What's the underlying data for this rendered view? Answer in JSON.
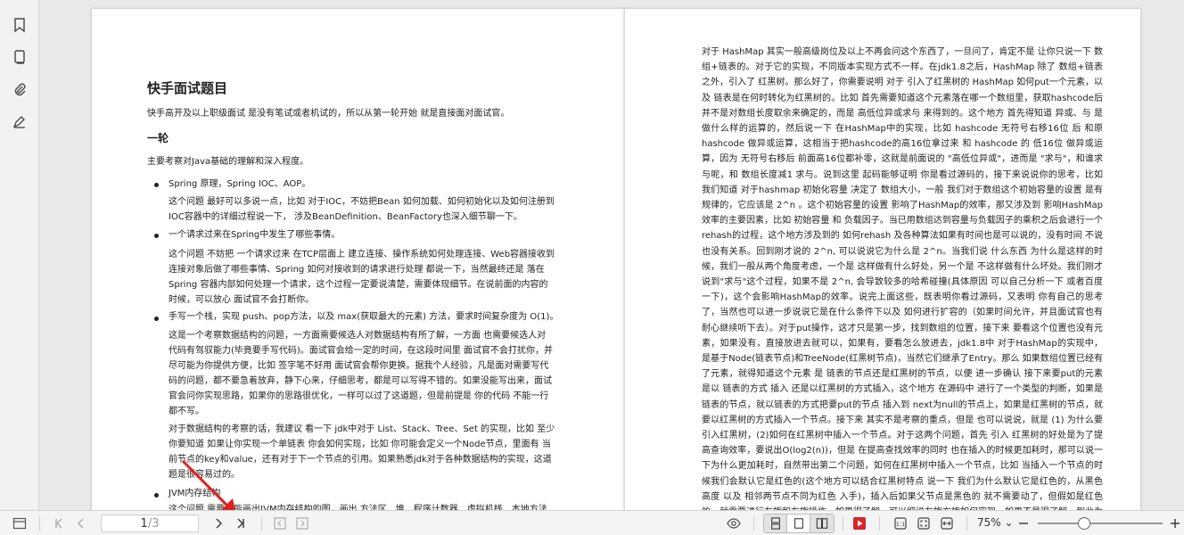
{
  "sidebar": {
    "items": [
      {
        "icon": "bookmark-icon"
      },
      {
        "icon": "thumbnails-icon"
      },
      {
        "icon": "attachment-icon"
      },
      {
        "icon": "signature-icon"
      }
    ]
  },
  "document": {
    "title": "快手面试题目",
    "intro": "快手高开及以上职级面试 是没有笔试或者机试的，所以从第一轮开始 就是直接面对面试官。",
    "section": "一轮",
    "section_intro": "主要考察对Java基础的理解和深入程度。",
    "bullets": [
      {
        "head": "Spring 原理，Spring IOC、AOP。",
        "body": [
          "这个问题 最好可以多说一点，比如 对于IOC，不妨把Bean 如何加载、如何初始化以及如何注册到",
          "IOC容器中的详细过程说一下， 涉及BeanDefinition、BeanFactory也深入细节聊一下。"
        ]
      },
      {
        "head": "一个请求过来在Spring中发生了哪些事情。",
        "body": [
          "这个问题 不妨把 一个请求过来 在TCP层面上 建立连接、操作系统如何处理连接、Web容器接收到",
          "连接对象后做了哪些事情、Spring 如何对接收到的请求进行处理 都说一下，当然最终还是 落在",
          "Spring 容器内部如何处理一个请求，这个过程一定要说清楚，需要体现细节。在说前面的内容的",
          "时候，可以放心 面试官不会打断你。"
        ]
      },
      {
        "head": "手写一个栈，实现 push、pop方法，以及 max(获取最大的元素) 方法，要求时间复杂度为 O(1)。",
        "body": [
          "这是一个考察数据结构的问题，一方面需要候选人对数据结构有所了解，一方面 也需要候选人对",
          "代码有驾驭能力(毕竟要手写代码)。面试官会给一定的时间，在这段时间里 面试官不会打扰你，并",
          "尽可能为你提供方便，比如 签字笔不好用 面试官会帮你更换。据我个人经验，凡是面对需要写代",
          "码的问题，都不要急着放弃，静下心来，仔细思考，都是可以写得不错的。如果没能写出来，面试",
          "官会问你实现思路，如果你的思路很优化，一样可以过了这道题，但是前提是 你的代码 不能一行",
          "都不写。"
        ],
        "body2": [
          "对于数据结构的考察的话，我建议 看一下 jdk中对于 List、Stack、Tree、Set 的实现，比如 至少",
          "你要知道 如果让你实现一个单链表 你会如何实现，比如 你可能会定义一个Node节点，里面有 当",
          "前节点的key和value，还有对于下一个节点的引用。如果熟悉jdk对于各种数据结构的实现，这道",
          "题是很容易过的。"
        ]
      },
      {
        "head": "JVM内存结构",
        "body": [
          "这个问题 需要你能画出JVM内存结构的图，画出 方法区、堆、程序计数器、虚拟机栈、本地方法"
        ]
      }
    ],
    "right_text": "对于 HashMap 其实一般高级岗位及以上不再会问这个东西了，一旦问了，肯定不是 让你只说一下 数组+链表的。对于它的实现，不同版本实现方式不一样。在jdk1.8之后，HashMap 除了 数组+链表 之外，引入了 红黑树。那么好了，你需要说明 对于 引入了红黑树的 HashMap 如何put一个元素，以及 链表是在何时转化为红黑树的。比如 首先需要知道这个元素落在哪一个数组里，获取hashcode后并不是对数组长度取余来确定的，而是 高低位异或求与 来得到的。这个地方 首先得知道 异或、与 是做什么样的运算的，然后说一下 在HashMap中的实现，比如 hashcode 无符号右移16位 后 和原hashcode 做异或运算，这相当于把hashcode的高16位拿过来 和 hashcode 的 低16位 做异或运算，因为 无符号右移后 前面高16位都补零，这就是前面说的 \"高低位异或\"，进而是 \"求与\"，和谁求与呢，和 数组长度减1 求与。说到这里 起码能够证明 你是看过源码的，接下来说说你的思考，比如 我们知道 对于hashmap 初始化容量 决定了 数组大小，一般 我们对于数组这个初始容量的设置 是有规律的，它应该是 2^n 。这个初始容量的设置 影响了HashMap的效率，那又涉及到 影响HashMap效率的主要因素，比如 初始容量 和 负载因子。当已用数组达到容量与负载因子的乘积之后会进行一个rehash的过程，这个地方涉及到的 如何rehash 及各种算法如果有时间也是可以说的，没有时间 不说也没有关系。回到刚才说的 2^n, 可以说说它为什么是 2^n。当我们说 什么东西 为什么是这样的时候，我们一般从两个角度考虑，一个是 这样做有什么好处，另一个是 不这样做有什么坏处。我们刚才说到\"求与\"这个过程，如果不是 2^n, 会导致较多的哈希碰撞(具体原因 可以自己分析一下 或者百度一下)，这个会影响HashMap的效率。说完上面这些，既表明你看过源码，又表明 你有自己的思考了，当然也可以进一步说说它是在什么条件下以及 如何进行扩容的（如果时间允许，并且面试官也有耐心继续听下去）。对于put操作，这才只是第一步，找到数组的位置，接下来 要看这个位置也没有元素，如果没有，直接放进去就可以，如果有，要看怎么放进去，jdk1.8中 对于HashMap的实现中，是基于Node(链表节点)和TreeNode(红黑树节点)，当然它们继承了Entry。那么 如果数组位置已经有了元素，就得知道这个元素 是 链表的节点还是红黑树的节点，以便 进一步确认 接下来要put的元素 是以 链表的方式 插入 还是以红黑树的方式插入，这个地方 在源码中 进行了一个类型的判断，如果是链表的节点，就以链表的方式把要put的节点 插入到 next为null的节点上，如果是红黑树的节点，就要以红黑树的方式插入一个节点。接下来 其实不是考察的重点，但是 也可以说说，就是 (1) 为什么要引入红黑树，(2)如何在红黑树中插入一个节点。对于这两个问题，首先 引入 红黑树的好处是为了提高查询效率，要说出O(log2(n))，但是 在提高查找效率的同时 也在插入的时候更加耗时，那可以说一下为什么更加耗时，自然带出第二个问题，如何在红黑树中插入一个节点，比如 当插入一个节点的时候我们会默认它是红色的(这个地方可以结合红黑树特点 说一下 我们为什么默认它是红色的，从黑色高度 以及 相邻两节点不同为红色 入手)，插入后如果父节点是黑色的 就不需要动了，但假如是红色的，就需要进行左旋和右旋操作，如果很了解，可以细说左旋右旋如何实现，如果不是很了解，到此为止也OK。"
  },
  "toolbar": {
    "current_page": "1",
    "total_pages": "/3",
    "zoom": "75%",
    "zoom_level": 0.37
  },
  "colors": {
    "record_red": "#d9252a",
    "arrow_red": "#e02020"
  }
}
